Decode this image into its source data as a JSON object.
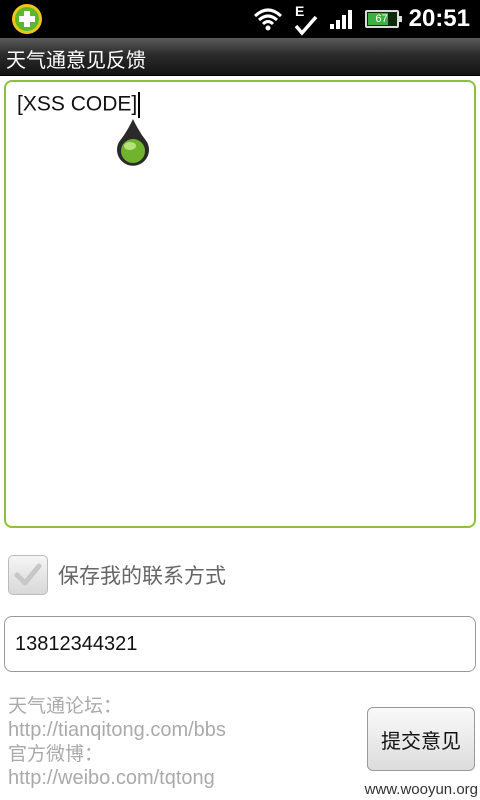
{
  "status_bar": {
    "time": "20:51",
    "battery_level": "67",
    "battery_fraction": 0.67,
    "network_type": "E",
    "icons": [
      "app-badge-icon",
      "wifi-icon",
      "edge-sync-icon",
      "signal-icon",
      "battery-icon"
    ]
  },
  "title_bar": {
    "title": "天气通意见反馈"
  },
  "feedback": {
    "value": "[XSS CODE]"
  },
  "contact_checkbox": {
    "label": "保存我的联系方式",
    "checked": true
  },
  "phone": {
    "value": "13812344321"
  },
  "footer": {
    "forum_label": "天气通论坛：",
    "forum_url": "http://tianqitong.com/bbs",
    "weibo_label": "官方微博：",
    "weibo_url": "http://weibo.com/tqtong"
  },
  "submit": {
    "label": "提交意见"
  },
  "watermark": "www.wooyun.org",
  "colors": {
    "accent": "#8fbf3a",
    "status_bar": "#000000",
    "title_bar": "#2b2b2b"
  }
}
